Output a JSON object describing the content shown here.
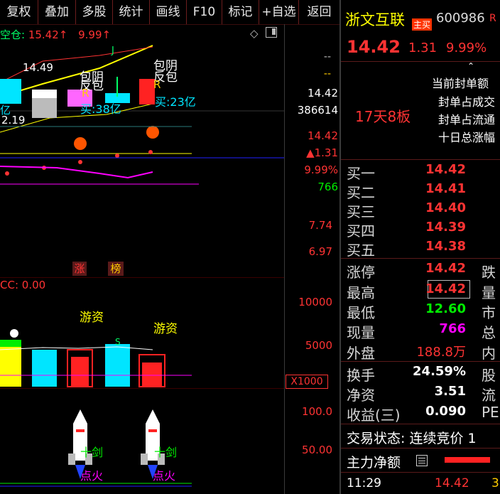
{
  "toolbar": {
    "items": [
      "复权",
      "叠加",
      "多股",
      "统计",
      "画线",
      "F10",
      "标记",
      "+自选",
      "返回"
    ]
  },
  "main_chart": {
    "header_left": "空仓: ",
    "header_up": "15.42↑",
    "header_up2": "9.99↑",
    "right_dash1": "--",
    "right_dash2": "--",
    "price_right": "14.42",
    "vol_right": "386614",
    "label_1449": "14.49",
    "label_219": "2.19",
    "label_yi": "亿",
    "baoyin1": "包阴",
    "fanbao1": "反包",
    "baoyin2": "包阴",
    "fanbao2": "反包",
    "r1": "R",
    "r2": "R",
    "buy23": "买:23亿",
    "buy38": "买:38亿",
    "j_mark": "J",
    "colors": {
      "up": "#ff3333",
      "down": "#00e5ff",
      "yellow": "#ffff00",
      "magenta": "#ff00ff"
    }
  },
  "sub_left_axis": {
    "v1442": "14.42",
    "v131": "▲1.31",
    "v999": "9.99%",
    "v766": "766",
    "v774": "7.74",
    "v697": "6.97",
    "v_cut": "0.00"
  },
  "tags": {
    "zhang": "涨",
    "bang": "榜"
  },
  "vol_chart": {
    "header": "CC: 0.00",
    "youzi1": "游资",
    "youzi2": "游资",
    "s_mark": "S",
    "y10000": "10000",
    "y5000": "5000",
    "unit": "X1000"
  },
  "rocket_chart": {
    "y100": "100.0",
    "y50": "50.00",
    "shijian1": "十剑",
    "shijian2": "十剑",
    "dianhuo1": "点火",
    "dianhuo2": "点火"
  },
  "panel": {
    "name": "浙文互联",
    "badge": "主买",
    "code": "600986",
    "code_suffix": "R",
    "price": "14.42",
    "change": "1.31",
    "pct": "9.99%",
    "boards": "17天8板",
    "seal_lines": [
      "当前封单额",
      "封单占成交",
      "封单占流通",
      "十日总涨幅"
    ],
    "bids": [
      {
        "label": "买一",
        "price": "14.42"
      },
      {
        "label": "买二",
        "price": "14.41"
      },
      {
        "label": "买三",
        "price": "14.40"
      },
      {
        "label": "买四",
        "price": "14.39"
      },
      {
        "label": "买五",
        "price": "14.38"
      }
    ],
    "stats": [
      {
        "label": "涨停",
        "value": "14.42",
        "color": "#ff3333",
        "right": "跌"
      },
      {
        "label": "最高",
        "value": "14.42",
        "color": "#ff3333",
        "right": "量"
      },
      {
        "label": "最低",
        "value": "12.60",
        "color": "#00ee00",
        "right": "市"
      },
      {
        "label": "现量",
        "value": "766",
        "color": "#ff00ff",
        "right": "总"
      },
      {
        "label": "外盘",
        "value": "188.8万",
        "color": "#ff3333",
        "right": "内"
      }
    ],
    "stats2": [
      {
        "label": "换手",
        "value": "24.59%",
        "right": "股"
      },
      {
        "label": "净资",
        "value": "3.51",
        "right": "流"
      },
      {
        "label": "收益(三)",
        "value": "0.090",
        "right": "PE"
      }
    ],
    "trade_status": "交易状态: 连续竞价 1",
    "main_net": "主力净额",
    "time": "11:29",
    "tick_price": "14.42",
    "tick_more": "3"
  }
}
